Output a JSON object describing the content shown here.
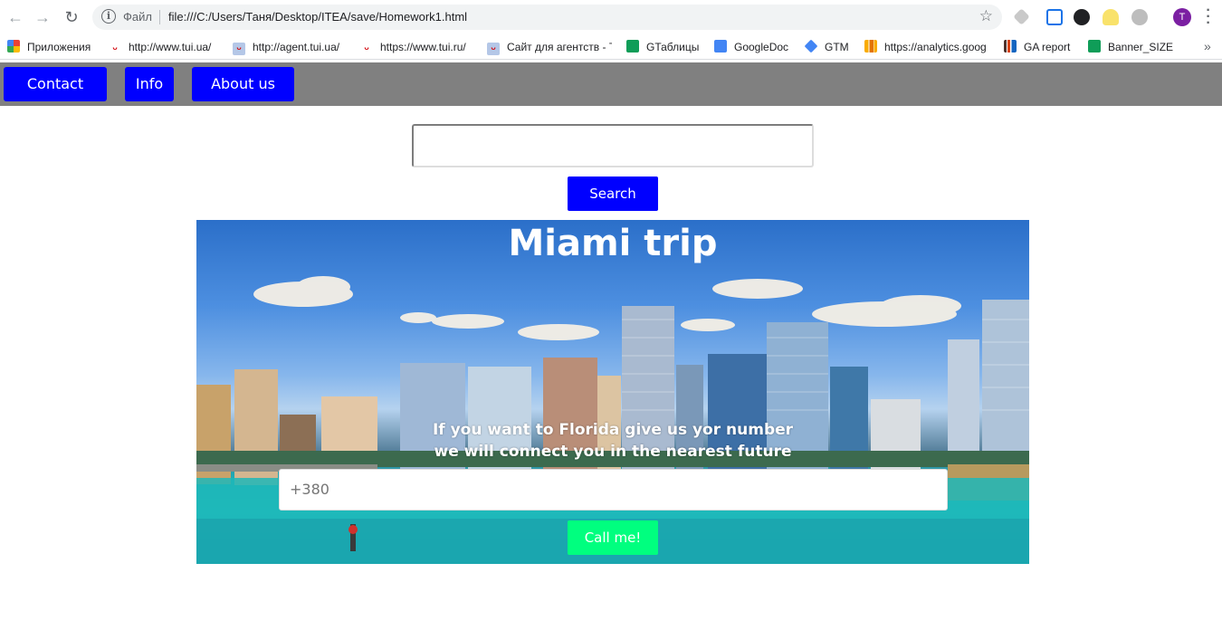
{
  "browser": {
    "omnibox_label": "Файл",
    "url": "file:///C:/Users/Таня/Desktop/ITEA/save/Homework1.html",
    "profile_initial": "T",
    "bookmarks": [
      {
        "label": "Приложения",
        "icon": "apps-grid-icon"
      },
      {
        "label": "http://www.tui.ua/",
        "icon": "tui-icon"
      },
      {
        "label": "http://agent.tui.ua/",
        "icon": "tui-icon"
      },
      {
        "label": "https://www.tui.ru/",
        "icon": "tui-icon"
      },
      {
        "label": "Сайт для агентств - Т",
        "icon": "tui-icon"
      },
      {
        "label": "GТаблицы",
        "icon": "sheets-icon"
      },
      {
        "label": "GoogleDoc",
        "icon": "docs-icon"
      },
      {
        "label": "GTM",
        "icon": "gtm-icon"
      },
      {
        "label": "https://analytics.goog",
        "icon": "analytics-icon"
      },
      {
        "label": "GA report",
        "icon": "chart-icon"
      },
      {
        "label": "Banner_SIZE",
        "icon": "sheets-icon"
      }
    ],
    "bookmarks_more": "»"
  },
  "nav": {
    "contact": "Contact",
    "info": "Info",
    "about": "About us"
  },
  "search": {
    "value": "",
    "button": "Search"
  },
  "hero": {
    "title": "Miami trip",
    "text_line1": "If you want to Florida give us yor number",
    "text_line2": "we will connect you in the nearest future",
    "phone_placeholder": "+380",
    "call_button": "Call me!"
  },
  "colors": {
    "nav_bg": "#808080",
    "button_blue": "#0000ff",
    "call_green": "#00ff7f"
  }
}
